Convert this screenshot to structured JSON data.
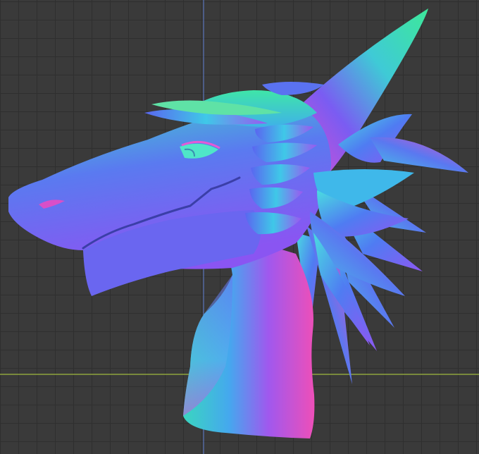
{
  "viewport": {
    "background_color": "#3a3a3a",
    "grid_line_color": "#2f2f2f",
    "axis_x_color": "#8ea33c",
    "axis_y_color": "#5a74b8"
  },
  "model": {
    "icon": "dragon-head-normal-map-mesh",
    "shading": "normal-map",
    "palette": {
      "green": "#3de89a",
      "cyan": "#3fc6e0",
      "blue": "#4f6cf0",
      "violet": "#8a55f2",
      "magenta": "#d452d8",
      "pink": "#ee4fb8"
    }
  }
}
